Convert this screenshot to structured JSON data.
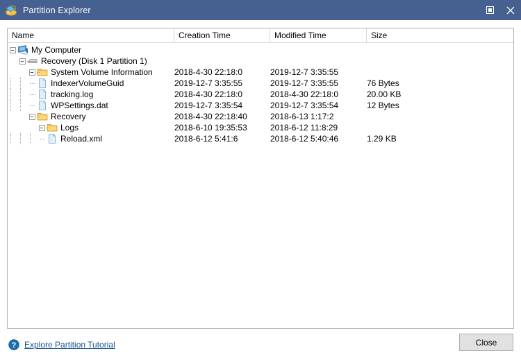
{
  "window": {
    "title": "Partition Explorer",
    "app_icon": "partition-explorer-icon",
    "controls": {
      "maximize_label": "Maximize",
      "maximize_icon": "maximize-icon",
      "close_label": "Close",
      "close_icon": "close-icon"
    },
    "accent_color": "#46608f"
  },
  "listview": {
    "columns": [
      {
        "label": "Name",
        "key": "name"
      },
      {
        "label": "Creation Time",
        "key": "creation"
      },
      {
        "label": "Modified Time",
        "key": "modified"
      },
      {
        "label": "Size",
        "key": "size"
      }
    ],
    "rows": [
      {
        "name": "My Computer",
        "icon": "computer-icon",
        "level": 0,
        "expander": "minus",
        "creation": "",
        "modified": "",
        "size": ""
      },
      {
        "name": "Recovery (Disk 1 Partition 1)",
        "icon": "drive-icon",
        "level": 1,
        "expander": "minus",
        "creation": "",
        "modified": "",
        "size": ""
      },
      {
        "name": "System Volume Information",
        "icon": "folder-icon",
        "level": 2,
        "expander": "minus",
        "creation": "2018-4-30 22:18:0",
        "modified": "2019-12-7 3:35:55",
        "size": ""
      },
      {
        "name": "IndexerVolumeGuid",
        "icon": "file-icon",
        "level": 3,
        "expander": "leaf",
        "creation": "2019-12-7 3:35:55",
        "modified": "2019-12-7 3:35:55",
        "size": "76 Bytes"
      },
      {
        "name": "tracking.log",
        "icon": "file-icon",
        "level": 3,
        "expander": "leaf",
        "creation": "2018-4-30 22:18:0",
        "modified": "2018-4-30 22:18:0",
        "size": "20.00 KB"
      },
      {
        "name": "WPSettings.dat",
        "icon": "file-icon",
        "level": 3,
        "expander": "leaf-last",
        "creation": "2019-12-7 3:35:54",
        "modified": "2019-12-7 3:35:54",
        "size": "12 Bytes"
      },
      {
        "name": "Recovery",
        "icon": "folder-icon",
        "level": 2,
        "expander": "minus",
        "creation": "2018-4-30 22:18:40",
        "modified": "2018-6-13 1:17:2",
        "size": ""
      },
      {
        "name": "Logs",
        "icon": "folder-icon",
        "level": 3,
        "expander": "minus",
        "creation": "2018-6-10 19:35:53",
        "modified": "2018-6-12 11:8:29",
        "size": ""
      },
      {
        "name": "Reload.xml",
        "icon": "file-icon",
        "level": 4,
        "expander": "leaf-last",
        "creation": "2018-6-12 5:41:6",
        "modified": "2018-6-12 5:40:46",
        "size": "1.29 KB"
      }
    ]
  },
  "footer": {
    "help_icon": "help-question-icon",
    "tutorial_link": "Explore Partition Tutorial",
    "close_label": "Close",
    "link_color": "#16538c"
  }
}
